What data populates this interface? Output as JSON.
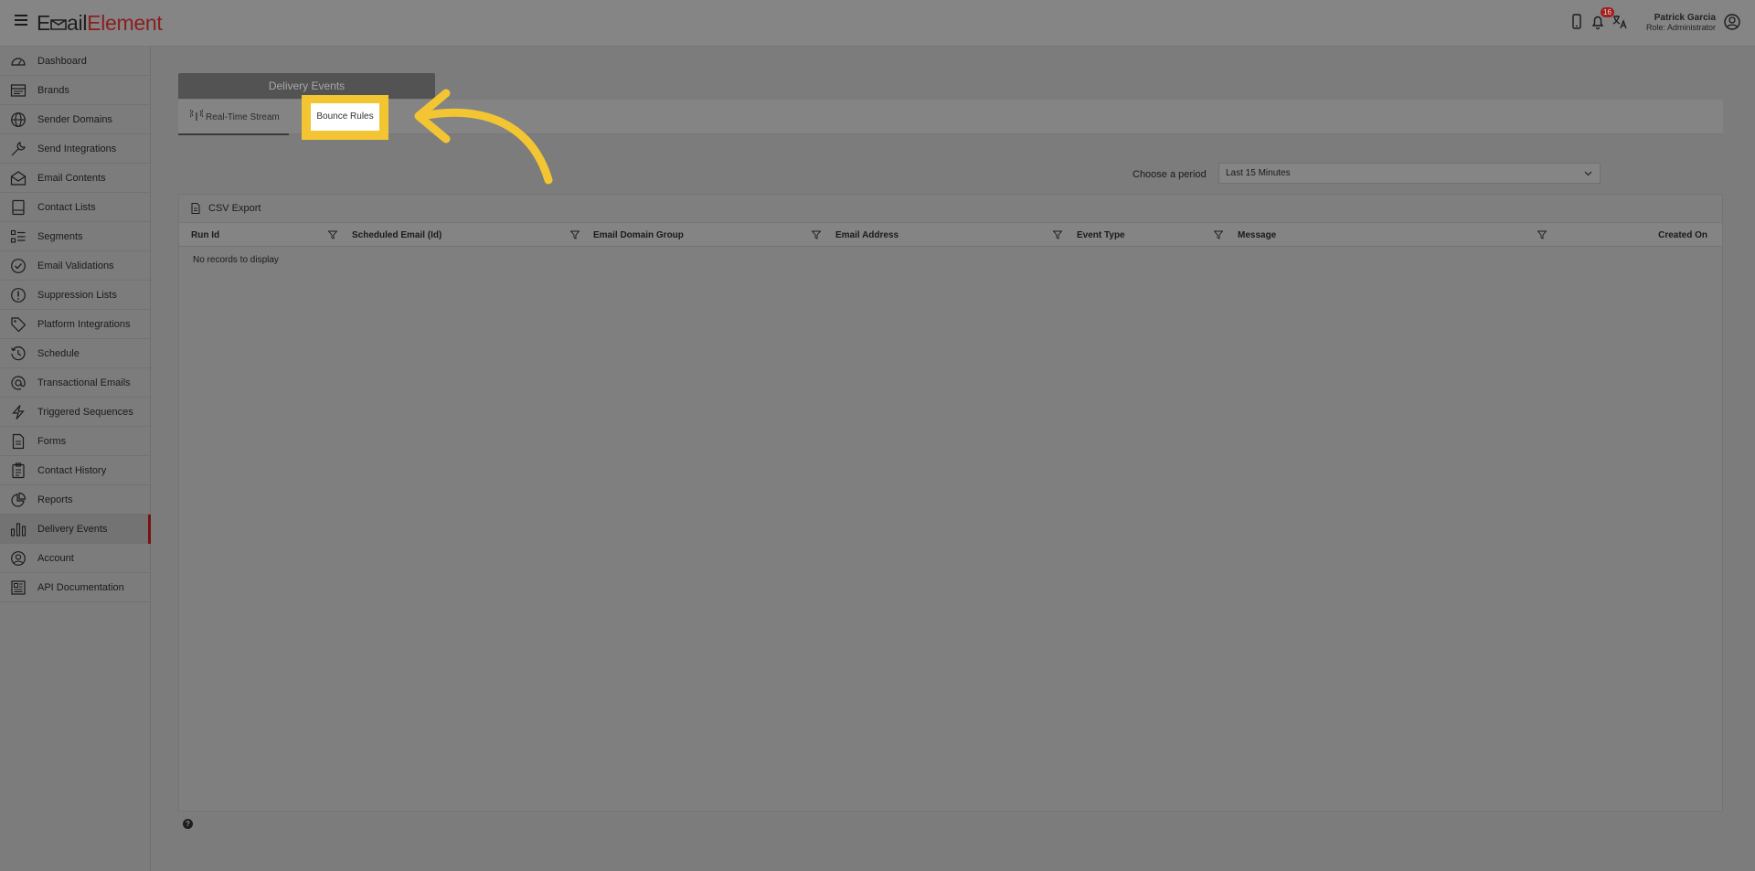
{
  "app": {
    "logo_part1": "E",
    "logo_part2": "ail",
    "logo_part3": "Element"
  },
  "header": {
    "notification_count": "16",
    "user_name": "Patrick Garcia",
    "user_role": "Role: Administrator",
    "icons": [
      "mobile-icon",
      "bell-icon",
      "language-icon",
      "user-circle-icon"
    ]
  },
  "sidebar": {
    "items": [
      {
        "label": "Dashboard",
        "icon": "gauge-icon"
      },
      {
        "label": "Brands",
        "icon": "brands-icon"
      },
      {
        "label": "Sender Domains",
        "icon": "globe-icon"
      },
      {
        "label": "Send Integrations",
        "icon": "wrench-icon"
      },
      {
        "label": "Email Contents",
        "icon": "envelope-icon"
      },
      {
        "label": "Contact Lists",
        "icon": "address-book-icon"
      },
      {
        "label": "Segments",
        "icon": "list-icon"
      },
      {
        "label": "Email Validations",
        "icon": "check-circle-icon"
      },
      {
        "label": "Suppression Lists",
        "icon": "exclamation-circle-icon"
      },
      {
        "label": "Platform Integrations",
        "icon": "tag-icon"
      },
      {
        "label": "Schedule",
        "icon": "history-icon"
      },
      {
        "label": "Transactional Emails",
        "icon": "at-icon"
      },
      {
        "label": "Triggered Sequences",
        "icon": "bolt-icon"
      },
      {
        "label": "Forms",
        "icon": "file-icon"
      },
      {
        "label": "Contact History",
        "icon": "clipboard-icon"
      },
      {
        "label": "Reports",
        "icon": "pie-chart-icon"
      },
      {
        "label": "Delivery Events",
        "icon": "bar-chart-icon"
      },
      {
        "label": "Account",
        "icon": "user-icon"
      },
      {
        "label": "API Documentation",
        "icon": "doc-icon"
      }
    ],
    "active_index": 16
  },
  "panel": {
    "title": "Delivery Events",
    "tabs": [
      {
        "label": "Real-Time Stream"
      },
      {
        "label": "Bounce Rules"
      }
    ],
    "highlight_color": "#f3c532"
  },
  "filter": {
    "period_label": "Choose a period",
    "period_value": "Last 15 Minutes"
  },
  "grid": {
    "csv_export": "CSV Export",
    "columns": [
      "Run Id",
      "Scheduled Email (Id)",
      "Email Domain Group",
      "Email Address",
      "Event Type",
      "Message",
      "Created On"
    ],
    "empty_message": "No records to display"
  },
  "help": "?"
}
